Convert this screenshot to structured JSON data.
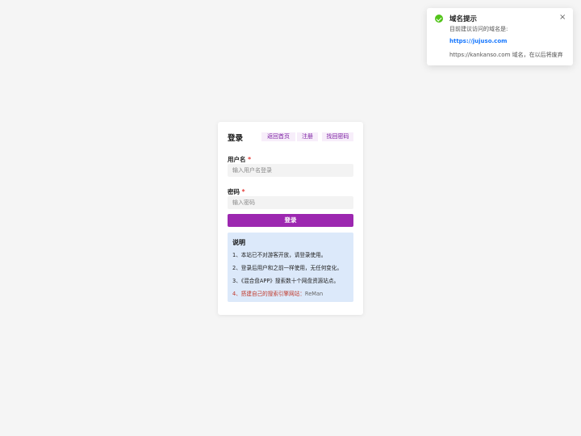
{
  "notification": {
    "title": "域名提示",
    "message": "目前建议访问的域名是:",
    "link": "https://jujuso.com",
    "note": "https://kankanso.com 域名，在以后将废弃",
    "close_icon": "×",
    "colors": {
      "success": "#52c41a",
      "link": "#1677ff"
    }
  },
  "login": {
    "heading": "登录",
    "nav": [
      "返回首页",
      "注册",
      "找回密码"
    ],
    "username_label": "用户名",
    "username_placeholder": "输入用户名登录",
    "password_label": "密码",
    "password_placeholder": "输入密码",
    "required_mark": "*",
    "submit_label": "登录",
    "colors": {
      "accent": "#9c27b0",
      "info_bg": "#dce9fa",
      "required": "#e53935"
    }
  },
  "info": {
    "title": "说明",
    "items": [
      "1、本站已不对游客开放，请登录使用。",
      "2、登录后用户和之前一样使用，无任何变化。",
      "3、《混合盘APP》搜索数十个网盘资源站点。",
      "4、搭建自己的搜索引擎网站："
    ],
    "item4_suffix": "ReMan"
  }
}
